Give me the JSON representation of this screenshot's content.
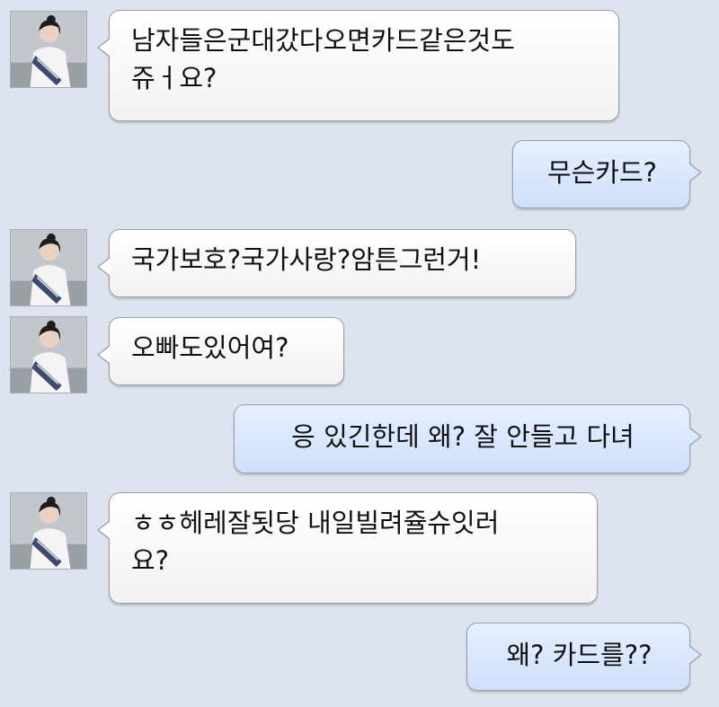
{
  "messages": [
    {
      "side": "in",
      "text": "남자들은군대갔다오면카드같은것도\n쥬ㅓ요?"
    },
    {
      "side": "out",
      "text": "무슨카드?"
    },
    {
      "side": "in",
      "text": "국가보호?국가사랑?암튼그런거!"
    },
    {
      "side": "in",
      "text": "오빠도있어여?"
    },
    {
      "side": "out",
      "text": "응 있긴한데 왜? 잘 안들고 다녀"
    },
    {
      "side": "in",
      "text": "ㅎㅎ헤레잘됫당 내일빌려쥴슈잇러\n요?"
    },
    {
      "side": "out",
      "text": "왜? 카드를??"
    }
  ],
  "colors": {
    "background": "#dde3ef",
    "incoming_bubble": "#ffffff",
    "outgoing_bubble": "#d7e6fc",
    "bubble_border": "#9aa0aa"
  },
  "icons": {
    "avatar": "contact-profile-photo"
  }
}
